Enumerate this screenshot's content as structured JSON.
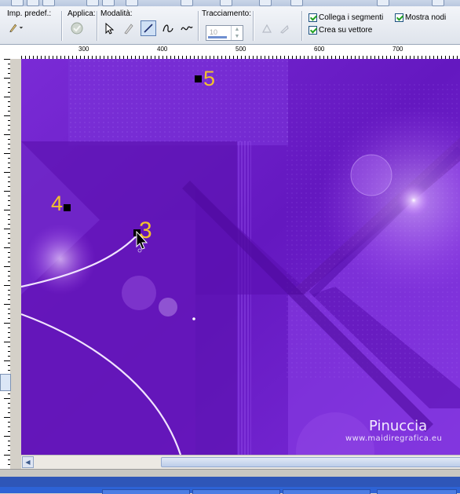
{
  "toolbar": {
    "preset_label": "Imp. predef.:",
    "apply_label": "Applica:",
    "mode_label": "Modalità:",
    "tracking_label": "Tracciamento:",
    "tracking_value": "10",
    "connect_segments_label": "Collega i segmenti",
    "create_vector_label": "Crea su vettore",
    "show_nodes_label": "Mostra nodi"
  },
  "ruler": {
    "top_labels": [
      "300",
      "400",
      "500",
      "600",
      "700"
    ]
  },
  "canvas": {
    "point_labels": [
      "5",
      "4",
      "3"
    ],
    "watermark_title": "Pinuccia",
    "watermark_url": "www.maidiregrafica.eu"
  },
  "colors": {
    "background": "#6f1fc9",
    "annotation": "#f2c12e",
    "node": "#000000"
  },
  "icons": [
    "pen-tool-icon",
    "apply-check-icon",
    "arrow-select-icon",
    "pen-icon",
    "line-icon",
    "bezier-icon",
    "freehand-icon",
    "triangle-icon",
    "knife-icon"
  ]
}
